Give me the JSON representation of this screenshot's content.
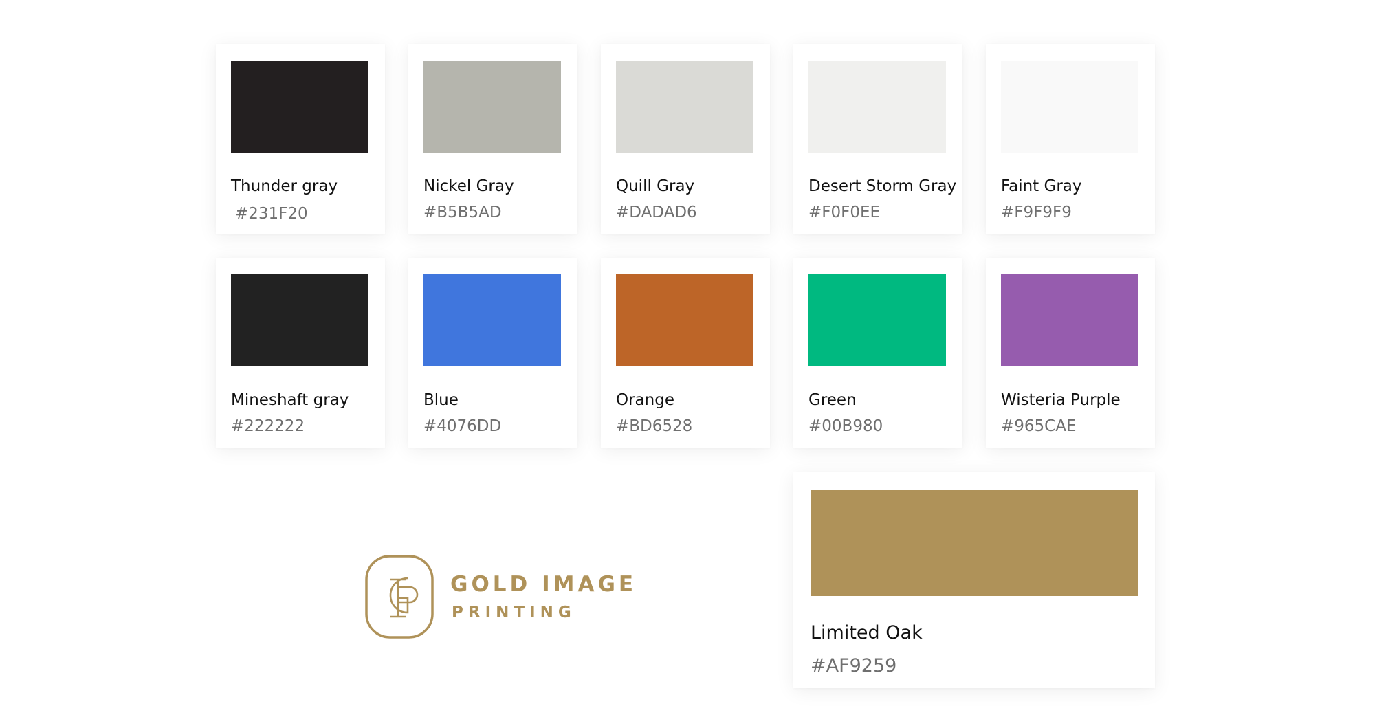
{
  "palette": {
    "row1": [
      {
        "name": "Thunder gray",
        "hex": "#231F20",
        "color": "#231F20"
      },
      {
        "name": "Nickel Gray",
        "hex": "#B5B5AD",
        "color": "#B5B5AD"
      },
      {
        "name": "Quill Gray",
        "hex": "#DADAD6",
        "color": "#DADAD6"
      },
      {
        "name": "Desert Storm Gray",
        "hex": "#F0F0EE",
        "color": "#F0F0EE"
      },
      {
        "name": "Faint Gray",
        "hex": "#F9F9F9",
        "color": "#F9F9F9"
      }
    ],
    "row2": [
      {
        "name": "Mineshaft gray",
        "hex": "#222222",
        "color": "#222222"
      },
      {
        "name": "Blue",
        "hex": "#4076DD",
        "color": "#4076DD"
      },
      {
        "name": "Orange",
        "hex": "#BD6528",
        "color": "#BD6528"
      },
      {
        "name": "Green",
        "hex": "#00B980",
        "color": "#00B980"
      },
      {
        "name": "Wisteria Purple",
        "hex": "#965CAE",
        "color": "#965CAE"
      }
    ],
    "featured": {
      "name": "Limited Oak",
      "hex": "#AF9259",
      "color": "#AF9259"
    }
  },
  "logo": {
    "line1": "GOLD IMAGE",
    "line2": "PRINTING",
    "monogram": "GIP",
    "icon": "gip-monogram-icon",
    "color": "#AF9259"
  }
}
